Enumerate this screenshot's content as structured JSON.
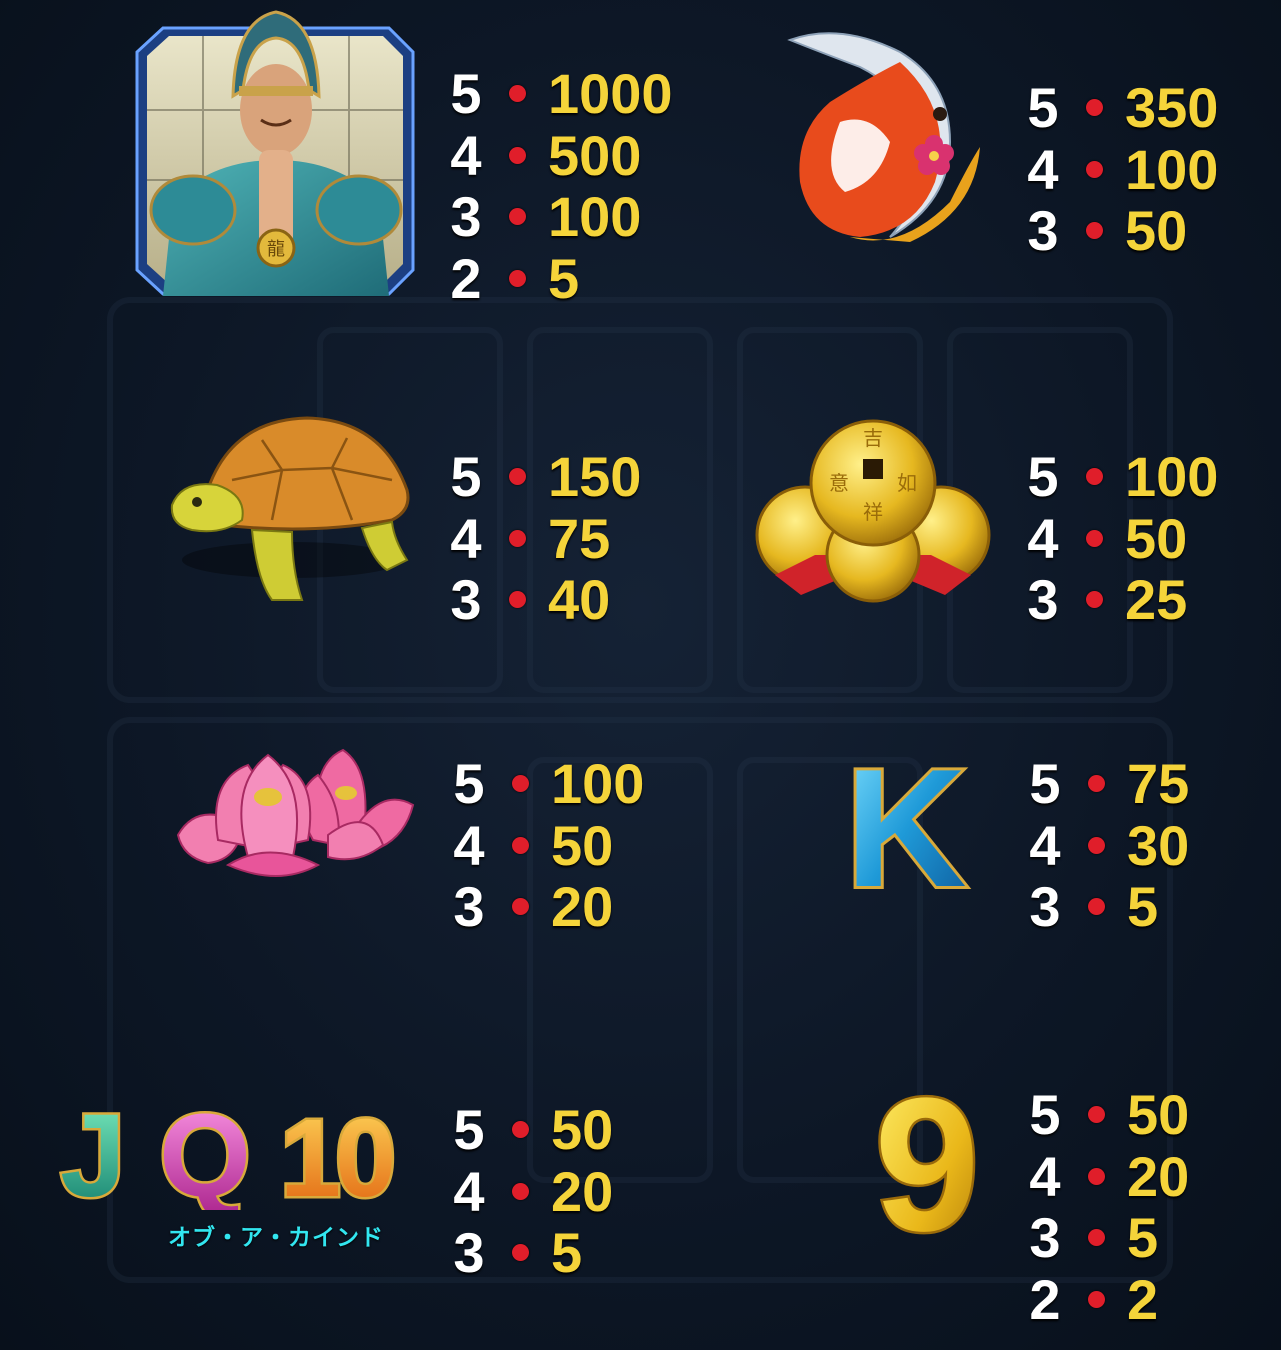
{
  "paytable": [
    {
      "symbol": "warrior",
      "rows": [
        {
          "count": "5",
          "payout": "1000"
        },
        {
          "count": "4",
          "payout": "500"
        },
        {
          "count": "3",
          "payout": "100"
        },
        {
          "count": "2",
          "payout": "5"
        }
      ]
    },
    {
      "symbol": "koi",
      "rows": [
        {
          "count": "5",
          "payout": "350"
        },
        {
          "count": "4",
          "payout": "100"
        },
        {
          "count": "3",
          "payout": "50"
        }
      ]
    },
    {
      "symbol": "turtle",
      "rows": [
        {
          "count": "5",
          "payout": "150"
        },
        {
          "count": "4",
          "payout": "75"
        },
        {
          "count": "3",
          "payout": "40"
        }
      ]
    },
    {
      "symbol": "coins",
      "rows": [
        {
          "count": "5",
          "payout": "100"
        },
        {
          "count": "4",
          "payout": "50"
        },
        {
          "count": "3",
          "payout": "25"
        }
      ]
    },
    {
      "symbol": "lotus",
      "rows": [
        {
          "count": "5",
          "payout": "100"
        },
        {
          "count": "4",
          "payout": "50"
        },
        {
          "count": "3",
          "payout": "20"
        }
      ]
    },
    {
      "symbol": "K",
      "rows": [
        {
          "count": "5",
          "payout": "75"
        },
        {
          "count": "4",
          "payout": "30"
        },
        {
          "count": "3",
          "payout": "5"
        }
      ]
    },
    {
      "symbol": "J Q 10",
      "rows": [
        {
          "count": "5",
          "payout": "50"
        },
        {
          "count": "4",
          "payout": "20"
        },
        {
          "count": "3",
          "payout": "5"
        }
      ]
    },
    {
      "symbol": "9",
      "rows": [
        {
          "count": "5",
          "payout": "50"
        },
        {
          "count": "4",
          "payout": "20"
        },
        {
          "count": "3",
          "payout": "5"
        },
        {
          "count": "2",
          "payout": "2"
        }
      ]
    }
  ],
  "letters": {
    "j": "J",
    "q": "Q",
    "ten": "10",
    "k": "K",
    "nine": "9"
  },
  "of_a_kind_label": "オブ・ア・カインド",
  "colors": {
    "background": "#0d1726",
    "count_text": "#ffffff",
    "payout_text": "#f5d43a",
    "bullet": "#e01e2a",
    "of_a_kind_text": "#32e6f0"
  }
}
